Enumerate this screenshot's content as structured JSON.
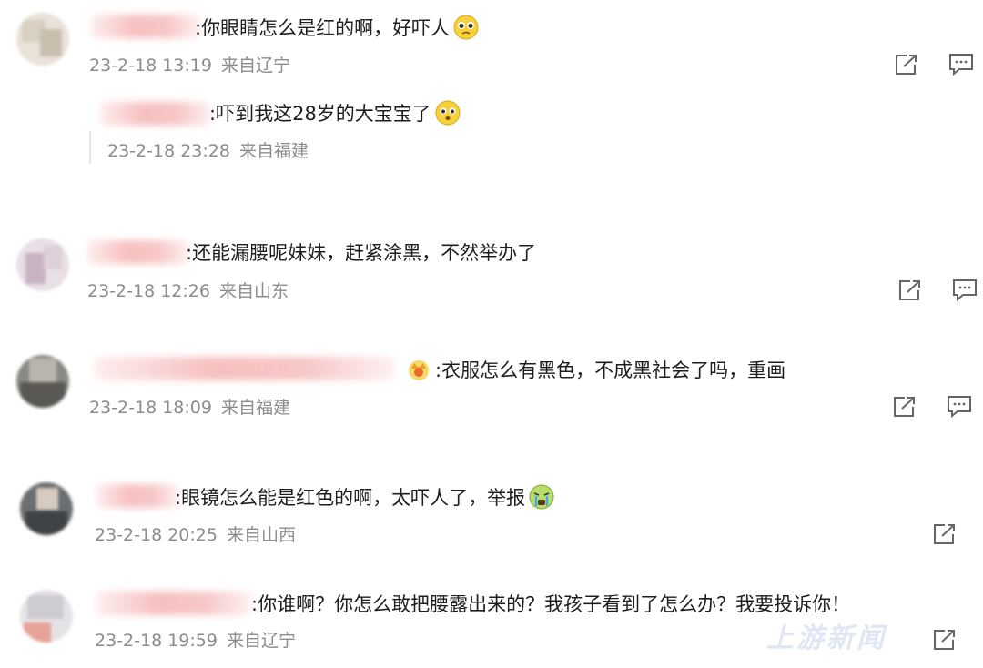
{
  "comments": [
    {
      "name_tail": ":",
      "text": "你眼睛怎么是红的啊，好吓人",
      "emoji": "pleading-face",
      "time": "23-2-18 13:19",
      "location": "来自辽宁",
      "has_share": true,
      "has_reply": true
    },
    {
      "name_tail": ":",
      "text": "吓到我这28岁的大宝宝了",
      "emoji": "pleading-face",
      "time": "23-2-18 23:28",
      "location": "来自福建",
      "is_reply": true
    },
    {
      "name_tail": ":",
      "text": "还能漏腰呢妹妹，赶紧涂黑，不然举办了",
      "emoji": "",
      "time": "23-2-18 12:26",
      "location": "来自山东",
      "has_share": true,
      "has_reply": true
    },
    {
      "name_tail": ":",
      "text": "衣服怎么有黑色，不成黑社会了吗，重画",
      "emoji": "crown-badge",
      "time": "23-2-18 18:09",
      "location": "来自福建",
      "has_share": true,
      "has_reply": true
    },
    {
      "name_tail": ":",
      "text": "眼镜怎么能是红色的啊，太吓人了，举报",
      "emoji": "crying-face",
      "time": "23-2-18 20:25",
      "location": "来自山西",
      "has_share": true,
      "has_reply": false
    },
    {
      "name_tail": ":",
      "text": "你谁啊？你怎么敢把腰露出来的？我孩子看到了怎么办？我要投诉你！",
      "emoji": "",
      "time": "23-2-18 19:59",
      "location": "来自辽宁",
      "has_share": true,
      "has_reply": false
    }
  ],
  "watermark": "上游新闻",
  "icons": {
    "share": "share-icon",
    "reply": "comment-icon"
  }
}
